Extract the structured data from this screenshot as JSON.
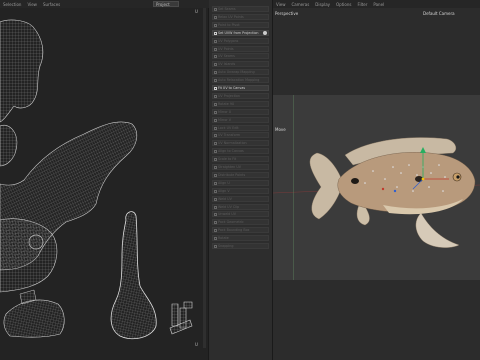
{
  "uv_editor": {
    "menu": [
      "Selection",
      "View",
      "Surfaces"
    ],
    "project_dropdown": "Project",
    "top_marker": "U",
    "bottom_marker": "U"
  },
  "tool_panel": {
    "items": [
      {
        "label": "Set Seams",
        "active": false
      },
      {
        "label": "Relax UV Points",
        "active": false
      },
      {
        "label": "Point to Pivot",
        "active": false
      },
      {
        "label": "Set UVW from Projection",
        "active": true,
        "gear": true
      },
      {
        "label": "UV Polygons",
        "active": false
      },
      {
        "label": "UV Points",
        "active": false
      },
      {
        "label": "UV Seams",
        "active": false
      },
      {
        "label": "UV Islands",
        "active": false
      },
      {
        "label": "Auto Unwrap Mapping",
        "active": false
      },
      {
        "label": "Auto Relaxation Mapping",
        "active": false
      },
      {
        "label": "Fit UV to Canvas",
        "active": true
      },
      {
        "label": "UV Projection",
        "active": false
      },
      {
        "label": "Rotate 90",
        "active": false
      },
      {
        "label": "Mirror U",
        "active": false
      },
      {
        "label": "Mirror V",
        "active": false
      },
      {
        "label": "Lock UV Edit",
        "active": false
      },
      {
        "label": "UV Transform",
        "active": false
      },
      {
        "label": "UV Normalization",
        "active": false
      },
      {
        "label": "Align to Canvas",
        "active": false
      },
      {
        "label": "Scale to Fit",
        "active": false
      },
      {
        "label": "Straighten UV",
        "active": false
      },
      {
        "label": "Distribute Points",
        "active": false
      },
      {
        "label": "Align U",
        "active": false
      },
      {
        "label": "Align V",
        "active": false
      },
      {
        "label": "Weld UV",
        "active": false
      },
      {
        "label": "Weld UV Clip",
        "active": false
      },
      {
        "label": "Unweld UV",
        "active": false
      },
      {
        "label": "Pack Geometric",
        "active": false
      },
      {
        "label": "Pack Bounding Box",
        "active": false
      },
      {
        "label": "Rotate",
        "active": false
      },
      {
        "label": "Snapping",
        "active": false
      }
    ]
  },
  "viewport": {
    "menu": [
      "View",
      "Cameras",
      "Display",
      "Options",
      "Filter",
      "Panel"
    ],
    "top_label": "Perspective",
    "camera_label": "Default Camera",
    "mid_label": "Move"
  },
  "colors": {
    "uv_lines": "#8e8e8e",
    "fish_body": "#b89a7c",
    "fish_fin": "#c8b9a3",
    "axis_x": "#c0392b",
    "axis_y": "#27ae60",
    "axis_z": "#2f5fd0"
  }
}
